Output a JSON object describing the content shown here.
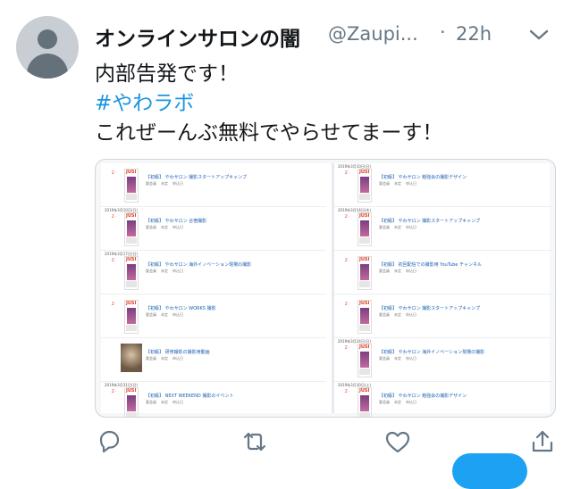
{
  "tweet": {
    "author_name": "オンラインサロンの闇",
    "handle": "@Zaupi...",
    "separator": "·",
    "time": "22h",
    "lines": [
      "内部告発です！",
      "#やわラボ",
      "これぜーんぶ無料でやらせてまーす！"
    ],
    "hashtag_color": "#1b95e0"
  },
  "media": {
    "left_entries": [
      {
        "label": "Z ·",
        "brand": "JUSI",
        "title": "【初級】 やわサロン 撮影スタートアップキャンプ",
        "meta": [
          "要会員",
          "未定",
          "申込日"
        ]
      },
      {
        "date": "2019年3月10日(日)",
        "label": "Z ·",
        "brand": "JUSI",
        "title": "【初級】 やわサロン 合宿撮影",
        "meta": [
          "要会員",
          "未定",
          "申込日"
        ]
      },
      {
        "date": "2019年3月17日(日)",
        "label": "Z ·",
        "brand": "JUSI",
        "title": "【初級】 やわサロン 海外イノベーション現場の撮影",
        "meta": [
          "要会員",
          "未定",
          "申込日"
        ]
      },
      {
        "label": "Z ·",
        "brand": "JUSI",
        "title": "【初級】 やわサロン WORKS 撮影",
        "meta": [
          "要会員",
          "未定",
          "申込日"
        ]
      },
      {
        "photo": true,
        "title": "【初級】 研修撮影の撮影用動画",
        "meta": [
          "要会員",
          "未定",
          "申込日"
        ]
      },
      {
        "date": "2019年3月31日(日)",
        "label": "Z ·",
        "brand": "JUSI",
        "title": "【初級】 NEXT WEEKEND 撮影のイベント",
        "meta": [
          "要会員",
          "未定",
          "申込日"
        ]
      }
    ],
    "right_entries": [
      {
        "date": "2019年3月10日(日)",
        "label": "Z ·",
        "brand": "JUSI",
        "title": "【初級】 やわサロン 勉強会の撮影デザイン",
        "meta": [
          "要会員",
          "未定",
          "申込日"
        ]
      },
      {
        "date": "2019年3月14日(木)",
        "label": "Z ·",
        "brand": "JUSI",
        "title": "【初級】 やわサロン 撮影スタートアップキャンプ",
        "meta": [
          "要会員",
          "未定",
          "申込日"
        ]
      },
      {
        "label": "Z ·",
        "brand": "JUSI",
        "title": "【初級】 初回配信での撮影用 YouTube チャンネル",
        "meta": [
          "要会員",
          "未定",
          "申込日"
        ]
      },
      {
        "label": "Z ·",
        "brand": "JUSI",
        "title": "【初級】 やわサロン 撮影スタートアップキャンプ",
        "meta": [
          "要会員",
          "未定",
          "申込日"
        ]
      },
      {
        "date": "2019年3月24日(日)",
        "label": "Z ·",
        "brand": "JUSI",
        "title": "【初級】 やわサロン 海外イノベーション現場の撮影",
        "meta": [
          "要会員",
          "未定",
          "申込日"
        ]
      },
      {
        "date": "2019年3月30日(土)",
        "label": "Z ·",
        "brand": "JUSI",
        "title": "【初級】 やわサロン 勉強会の撮影デザイン",
        "meta": [
          "要会員",
          "未定",
          "申込日"
        ]
      }
    ]
  },
  "actions": {
    "icons": [
      "reply-icon",
      "retweet-icon",
      "like-icon",
      "share-icon"
    ],
    "accent": "#657786"
  }
}
